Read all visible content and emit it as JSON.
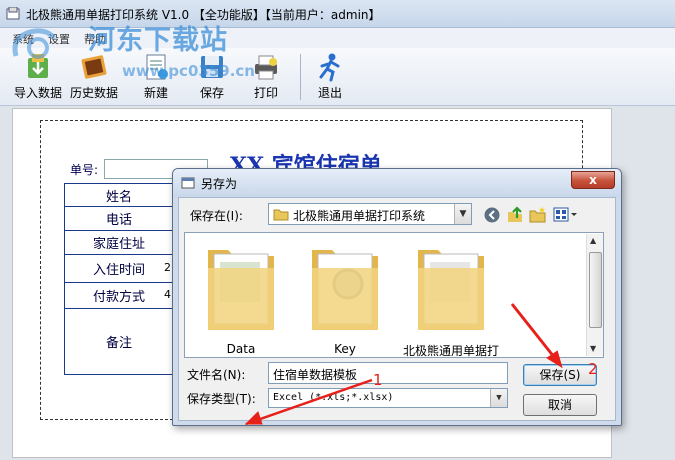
{
  "window": {
    "title": "北极熊通用单据打印系统 V1.0 【全功能版】【当前用户：admin】"
  },
  "watermark": {
    "text": "河东下载站",
    "url": "www.pc0359.cn"
  },
  "menu": {
    "items": [
      "系统",
      "设置",
      "帮助"
    ]
  },
  "toolbar": {
    "buttons": [
      {
        "label": "导入数据",
        "icon": "import-icon"
      },
      {
        "label": "历史数据",
        "icon": "history-icon"
      },
      {
        "label": "新建",
        "icon": "new-icon"
      },
      {
        "label": "保存",
        "icon": "save-icon"
      },
      {
        "label": "打印",
        "icon": "print-icon"
      },
      {
        "label": "退出",
        "icon": "exit-icon"
      }
    ]
  },
  "document": {
    "number_label": "单号:",
    "title": "XX 宾馆住宿单",
    "fields": [
      "姓名",
      "电话",
      "家庭住址",
      "入住时间",
      "付款方式",
      "备注"
    ],
    "field_values": [
      "",
      "",
      "",
      "2",
      "4",
      ""
    ]
  },
  "dialog": {
    "title": "另存为",
    "close_label": "x",
    "save_in_label": "保存在(I):",
    "save_in_value": "北极熊通用单据打印系统",
    "files": [
      {
        "name": "Data",
        "icon": "folder-icon"
      },
      {
        "name": "Key",
        "icon": "folder-icon"
      },
      {
        "name": "北极熊通用单据打",
        "icon": "folder-icon"
      }
    ],
    "filename_label": "文件名(N):",
    "filename_value": "住宿单数据模板",
    "filetype_label": "保存类型(T):",
    "filetype_value": "Excel (*.xls;*.xlsx)",
    "save_button": "保存(S)",
    "cancel_button": "取消"
  },
  "annotations": {
    "marker1": "1",
    "marker2": "2",
    "color": "#e8201a"
  }
}
